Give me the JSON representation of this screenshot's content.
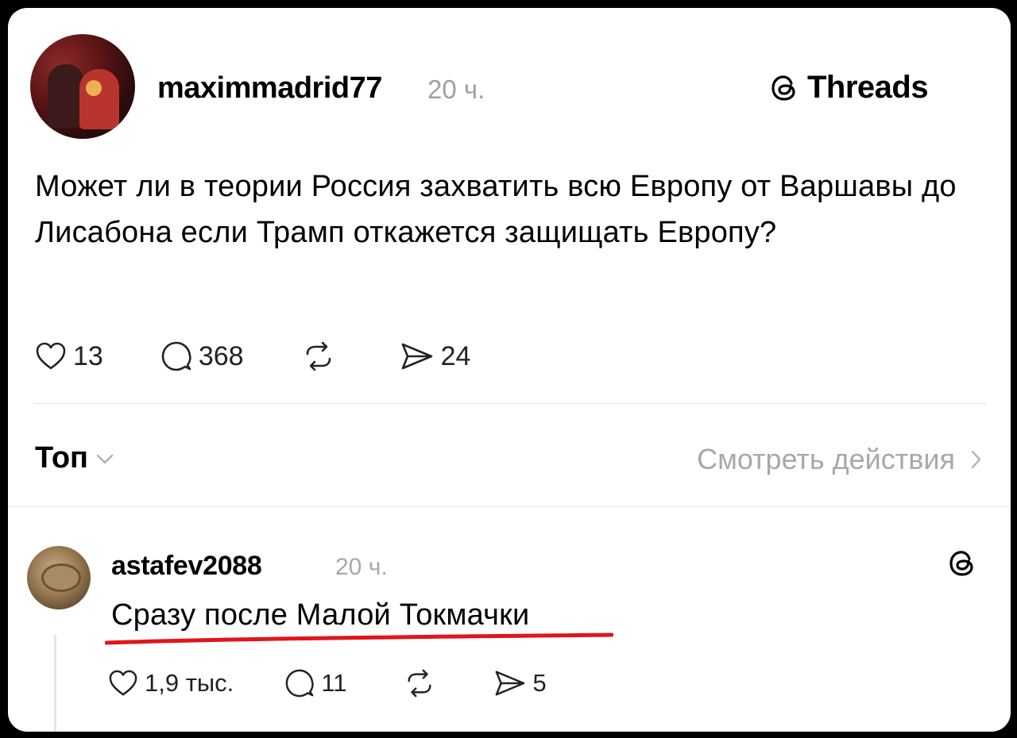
{
  "post": {
    "username": "maximmadrid77",
    "time": "20 ч.",
    "brand": "Threads",
    "text": "Может ли в теории Россия захватить всю Европу от Варшавы до Лисабона если Трамп откажется защищать Европу?",
    "likes": "13",
    "replies": "368",
    "shares": "24"
  },
  "sort": {
    "label": "Топ",
    "view_activity": "Смотреть действия"
  },
  "reply": {
    "username": "astafev2088",
    "time": "20 ч.",
    "text": "Сразу после Малой Токмачки",
    "likes": "1,9 тыс.",
    "replies": "11",
    "shares": "5"
  },
  "colors": {
    "underline": "#e0161c",
    "muted": "#a0a0a0"
  }
}
